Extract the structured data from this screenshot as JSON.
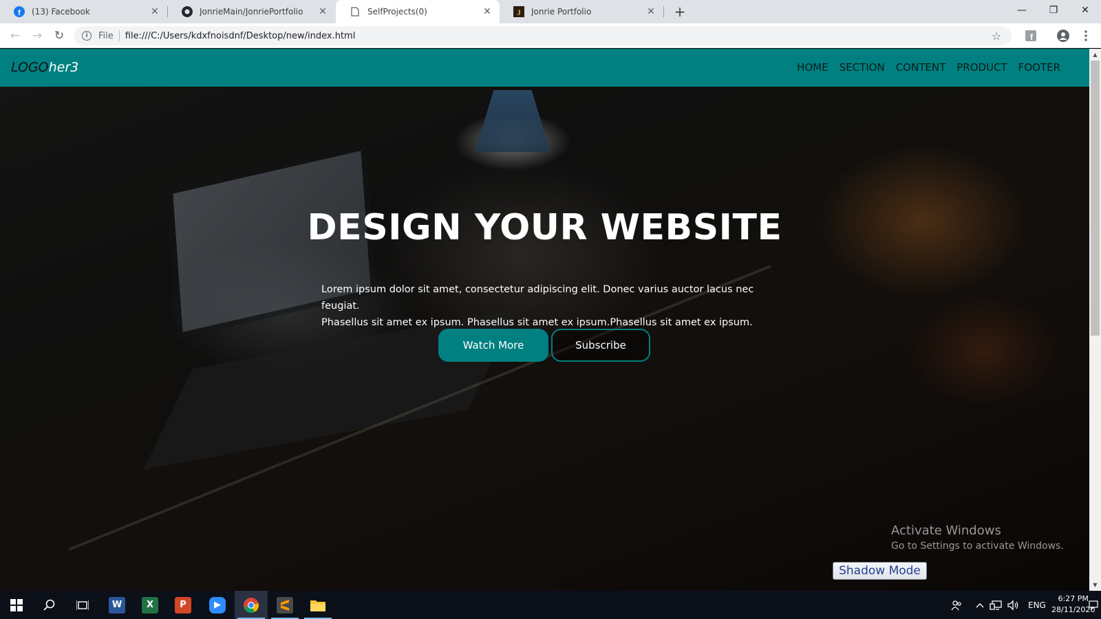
{
  "browser": {
    "tabs": [
      {
        "title": "(13) Facebook",
        "icon": "facebook-icon"
      },
      {
        "title": "JonrieMain/JonriePortfolio",
        "icon": "github-icon"
      },
      {
        "title": "SelfProjects(0)",
        "icon": "page-icon",
        "active": true
      },
      {
        "title": "Jonrie Portfolio",
        "icon": "portfolio-icon"
      }
    ],
    "scheme_label": "File",
    "url": "file:///C:/Users/kdxfnoisdnf/Desktop/new/index.html"
  },
  "page": {
    "logo_a": "LOGO",
    "logo_b": "her3",
    "nav": [
      "HOME",
      "SECTION",
      "CONTENT",
      "PRODUCT",
      "FOOTER"
    ],
    "hero_title": "DESIGN YOUR WEBSITE",
    "hero_line1": "Lorem ipsum dolor sit amet, consectetur adipiscing elit. Donec varius auctor lacus nec feugiat.",
    "hero_line2": "Phasellus sit amet ex ipsum. Phasellus sit amet ex ipsum.Phasellus sit amet ex ipsum.",
    "watch_label": "Watch More",
    "subscribe_label": "Subscribe",
    "accent_color": "#008080"
  },
  "overlay": {
    "activate_title": "Activate Windows",
    "activate_sub": "Go to Settings to activate Windows.",
    "shadow_mode": "Shadow Mode"
  },
  "taskbar": {
    "apps": [
      "start-icon",
      "search-icon",
      "task-view-icon",
      "word-icon",
      "excel-icon",
      "powerpoint-icon",
      "zoom-icon",
      "chrome-icon",
      "sublime-icon",
      "file-explorer-icon"
    ],
    "language": "ENG",
    "time": "6:27 PM",
    "date": "28/11/2020"
  }
}
